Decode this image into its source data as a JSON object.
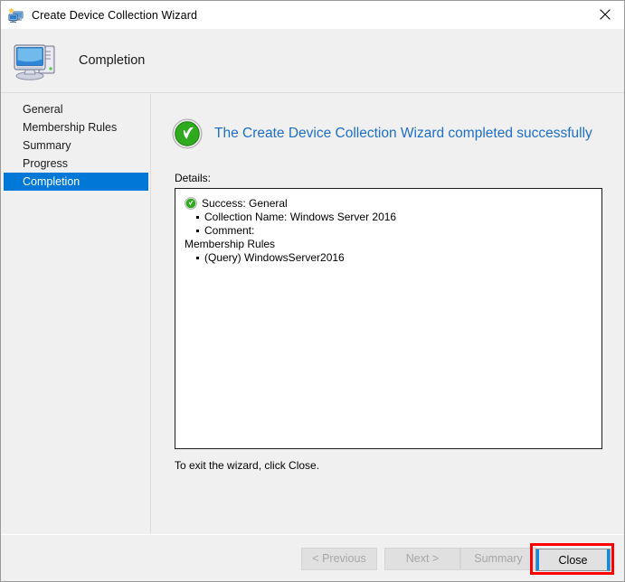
{
  "window": {
    "title": "Create Device Collection Wizard",
    "title_icon": "device-collection-icon",
    "close_icon": "close-icon"
  },
  "header": {
    "title": "Completion",
    "icon": "computer-icon"
  },
  "sidebar": {
    "items": [
      {
        "label": "General",
        "selected": false
      },
      {
        "label": "Membership Rules",
        "selected": false
      },
      {
        "label": "Summary",
        "selected": false
      },
      {
        "label": "Progress",
        "selected": false
      },
      {
        "label": "Completion",
        "selected": true
      }
    ]
  },
  "main": {
    "success_icon": "success-check-icon",
    "success_message": "The Create Device Collection Wizard completed successfully",
    "details_label": "Details:",
    "details": {
      "status_icon": "success-check-small-icon",
      "status_line": "Success: General",
      "general_items": [
        "Collection Name: Windows Server 2016",
        "Comment:"
      ],
      "group_label": "Membership Rules",
      "membership_items": [
        "(Query) WindowsServer2016"
      ]
    },
    "exit_hint": "To exit the wizard, click Close."
  },
  "footer": {
    "previous_label": "< Previous",
    "next_label": "Next >",
    "summary_label": "Summary",
    "close_label": "Close"
  },
  "colors": {
    "accent_blue": "#0078d7",
    "heading_blue": "#1e6fc4",
    "success_green": "#3cb52e",
    "annotation_red": "#ff0000",
    "focus_blue": "#0c8ce9",
    "window_bg": "#f0f0f0"
  }
}
